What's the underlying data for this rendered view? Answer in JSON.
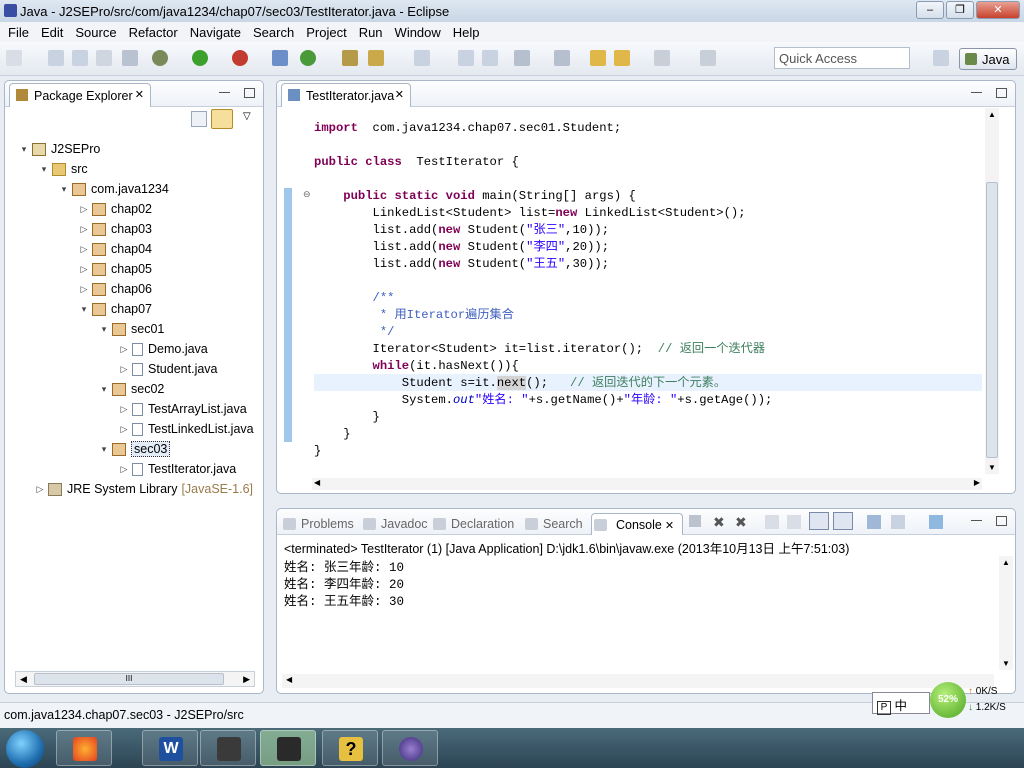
{
  "window": {
    "title": "Java - J2SEPro/src/com/java1234/chap07/sec03/TestIterator.java - Eclipse"
  },
  "menu": [
    "File",
    "Edit",
    "Source",
    "Refactor",
    "Navigate",
    "Search",
    "Project",
    "Run",
    "Window",
    "Help"
  ],
  "toolbar": {
    "quick_access_placeholder": "Quick Access",
    "perspective": "Java"
  },
  "package_explorer": {
    "tab": "Package Explorer",
    "tree": [
      {
        "label": "J2SEPro",
        "type": "proj",
        "depth": 0,
        "tw": "▾"
      },
      {
        "label": "src",
        "type": "folder",
        "depth": 1,
        "tw": "▾"
      },
      {
        "label": "com.java1234",
        "type": "pkg",
        "depth": 2,
        "tw": "▾"
      },
      {
        "label": "chap02",
        "type": "pkg",
        "depth": 3,
        "tw": "▷"
      },
      {
        "label": "chap03",
        "type": "pkg",
        "depth": 3,
        "tw": "▷"
      },
      {
        "label": "chap04",
        "type": "pkg",
        "depth": 3,
        "tw": "▷"
      },
      {
        "label": "chap05",
        "type": "pkg",
        "depth": 3,
        "tw": "▷"
      },
      {
        "label": "chap06",
        "type": "pkg",
        "depth": 3,
        "tw": "▷"
      },
      {
        "label": "chap07",
        "type": "pkg",
        "depth": 3,
        "tw": "▾"
      },
      {
        "label": "sec01",
        "type": "pkg",
        "depth": 4,
        "tw": "▾"
      },
      {
        "label": "Demo.java",
        "type": "file",
        "depth": 5,
        "tw": "▷"
      },
      {
        "label": "Student.java",
        "type": "file",
        "depth": 5,
        "tw": "▷"
      },
      {
        "label": "sec02",
        "type": "pkg",
        "depth": 4,
        "tw": "▾"
      },
      {
        "label": "TestArrayList.java",
        "type": "file",
        "depth": 5,
        "tw": "▷"
      },
      {
        "label": "TestLinkedList.java",
        "type": "file",
        "depth": 5,
        "tw": "▷"
      },
      {
        "label": "sec03",
        "type": "pkg",
        "depth": 4,
        "tw": "▾",
        "selected": true
      },
      {
        "label": "TestIterator.java",
        "type": "file",
        "depth": 5,
        "tw": "▷"
      },
      {
        "label": "JRE System Library",
        "type": "lib",
        "depth": 1,
        "tw": "▷",
        "decoration": "[JavaSE-1.6]"
      }
    ],
    "hscroll_thumb": "III"
  },
  "editor": {
    "tab": "TestIterator.java",
    "lines": [
      [
        [
          "kw",
          "import"
        ],
        [
          "",
          "  com.java1234.chap07.sec01.Student;"
        ]
      ],
      [],
      [
        [
          "kw",
          "public class"
        ],
        [
          "",
          "  TestIterator {"
        ]
      ],
      [],
      [
        [
          "",
          "    "
        ],
        [
          "kw",
          "public static void"
        ],
        [
          "",
          " main(String[] args) {"
        ]
      ],
      [
        [
          "",
          "        LinkedList<Student> list="
        ],
        [
          "kw",
          "new"
        ],
        [
          "",
          " LinkedList<Student>();"
        ]
      ],
      [
        [
          "",
          "        list.add("
        ],
        [
          "kw",
          "new"
        ],
        [
          "",
          " Student("
        ],
        [
          "str",
          "\"张三\""
        ],
        [
          "",
          ",10));"
        ]
      ],
      [
        [
          "",
          "        list.add("
        ],
        [
          "kw",
          "new"
        ],
        [
          "",
          " Student("
        ],
        [
          "str",
          "\"李四\""
        ],
        [
          "",
          ",20));"
        ]
      ],
      [
        [
          "",
          "        list.add("
        ],
        [
          "kw",
          "new"
        ],
        [
          "",
          " Student("
        ],
        [
          "str",
          "\"王五\""
        ],
        [
          "",
          ",30));"
        ]
      ],
      [],
      [
        [
          "jd",
          "        /**"
        ]
      ],
      [
        [
          "jd",
          "         * 用Iterator遍历集合"
        ]
      ],
      [
        [
          "jd",
          "         */"
        ]
      ],
      [
        [
          "",
          "        Iterator<Student> it=list.iterator();  "
        ],
        [
          "cm",
          "// 返回一个迭代器"
        ]
      ],
      [
        [
          "kw",
          "        while"
        ],
        [
          "",
          "(it.hasNext()){"
        ]
      ],
      [
        [
          "",
          "            Student s=it."
        ],
        [
          "occ",
          "next"
        ],
        [
          "",
          "();   "
        ],
        [
          "cm",
          "// 返回迭代的下一个元素。"
        ]
      ],
      [
        [
          "",
          "            System."
        ],
        [
          "fld",
          "out"
        ],
        [
          ".println(",
          ""
        ],
        [
          "str",
          "\"姓名: \""
        ],
        [
          "",
          "+s.getName()+"
        ],
        [
          "str",
          "\"年龄: \""
        ],
        [
          "",
          "+s.getAge());"
        ]
      ],
      [
        [
          "",
          "        }"
        ]
      ],
      [
        [
          "",
          "    }"
        ]
      ],
      [
        [
          "",
          "}"
        ]
      ]
    ]
  },
  "console": {
    "tabs": [
      "Problems",
      "Javadoc",
      "Declaration",
      "Search",
      "Console"
    ],
    "header": "<terminated> TestIterator (1) [Java Application] D:\\jdk1.6\\bin\\javaw.exe (2013年10月13日 上午7:51:03)",
    "output": [
      "姓名: 张三年龄: 10",
      "姓名: 李四年龄: 20",
      "姓名: 王五年龄: 30"
    ]
  },
  "status": {
    "path": "com.java1234.chap07.sec03 - J2SEPro/src"
  },
  "tray": {
    "ime": "中",
    "cpu": "52%",
    "up": "0K/S",
    "down": "1.2K/S"
  },
  "watermark": ""
}
